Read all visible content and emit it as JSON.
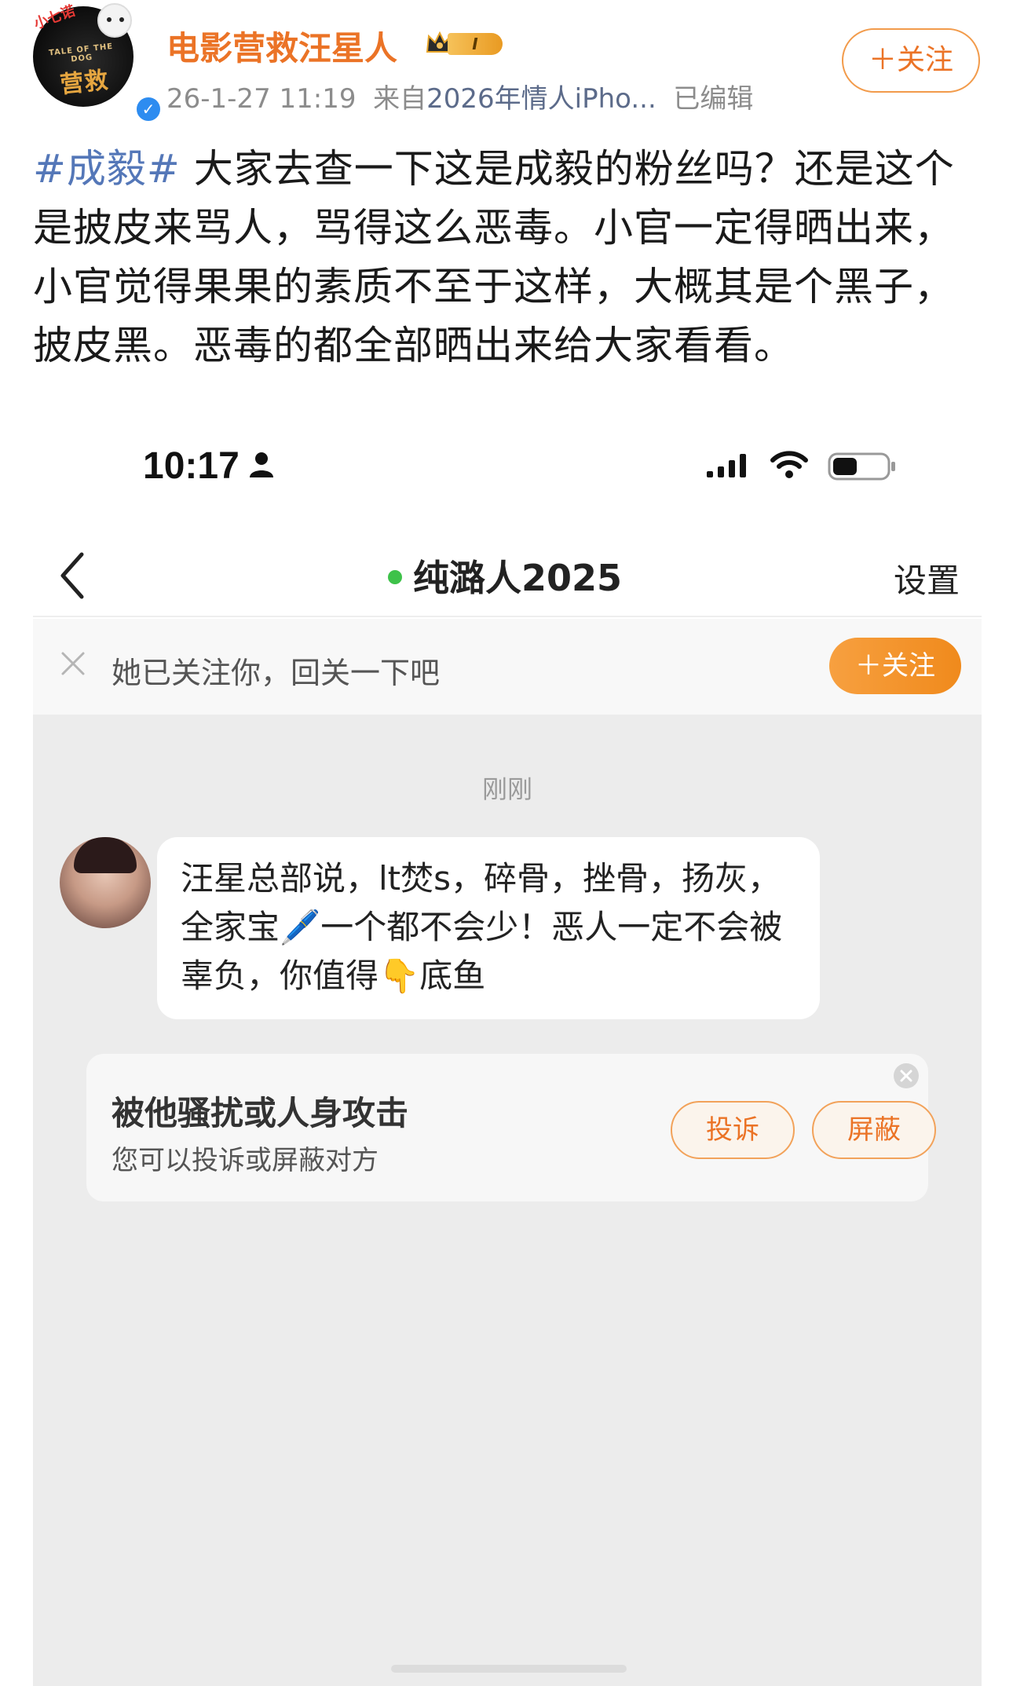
{
  "post": {
    "author": {
      "name": "电影营救汪星人",
      "avatar_text": "营救",
      "avatar_sub": "TALE OF THE DOG",
      "avatar_tag": "小七诺",
      "verified_mark": "✓",
      "level": "I"
    },
    "meta": {
      "timestamp": "26-1-27 11:19",
      "source_prefix": "来自",
      "source": "2026年情人iPho...",
      "edited": "已编辑"
    },
    "follow_label": "＋关注",
    "hashtag": "#成毅#",
    "text": " 大家去查一下这是成毅的粉丝吗？还是这个是披皮来骂人，骂得这么恶毒。小官一定得晒出来，小官觉得果果的素质不至于这样，大概其是个黑子，披皮黑。恶毒的都全部晒出来给大家看看。"
  },
  "phone": {
    "status_bar": {
      "time": "10:17"
    },
    "chat_header": {
      "title": "纯潞人2025",
      "settings": "设置"
    },
    "follow_bar": {
      "text": "她已关注你，回关一下吧",
      "button": "＋关注"
    },
    "chat": {
      "timestamp": "刚刚",
      "message": "汪星总部说，lt焚s，碎骨，挫骨，扬灰，全家宝🖊️一个都不会少！恶人一定不会被辜负，你值得👇底鱼"
    },
    "report_card": {
      "title": "被他骚扰或人身攻击",
      "subtitle": "您可以投诉或屏蔽对方",
      "complain": "投诉",
      "block": "屏蔽"
    }
  },
  "colors": {
    "accent_orange": "#eb7326",
    "link_blue": "#5477b8",
    "online_green": "#3ec24a",
    "chat_bg": "#ececec"
  }
}
